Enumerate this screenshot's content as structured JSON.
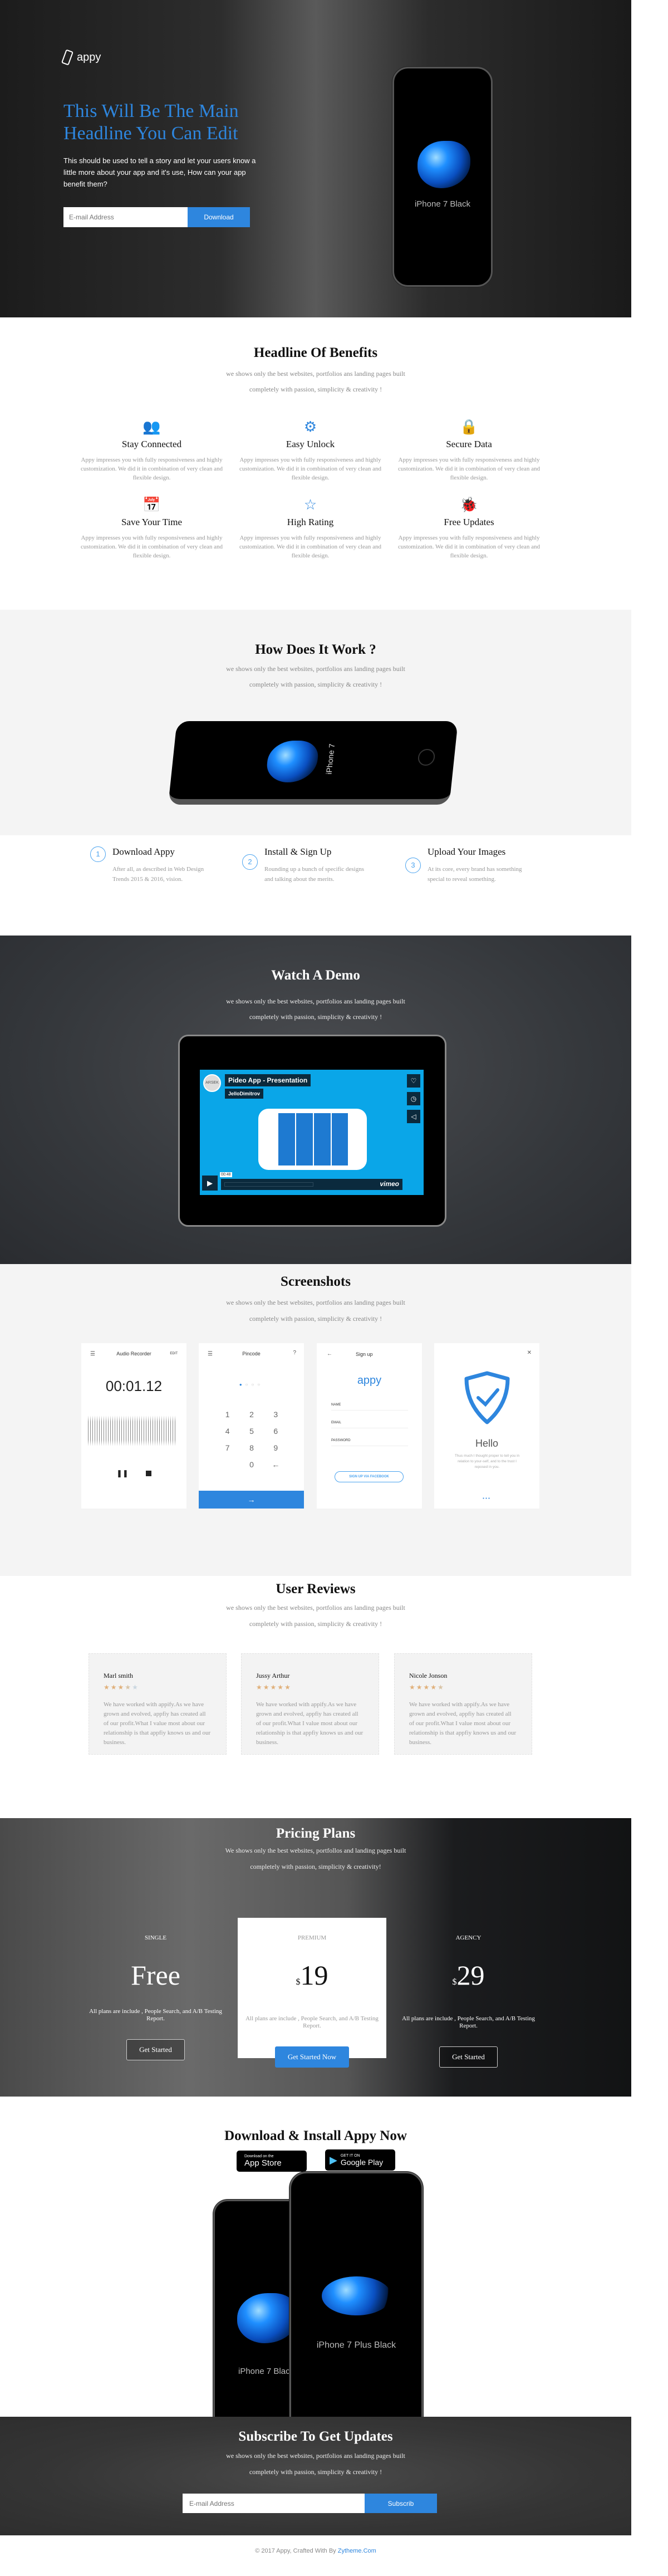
{
  "colors": {
    "accent": "#2e86de",
    "dark": "#2b2b2b",
    "gray_bg": "#f4f4f4"
  },
  "hero": {
    "logo_text": "appy",
    "logo_icon": "phone-outline-icon",
    "headline": "This Will Be The Main Headline You Can Edit",
    "description": "This should be used to tell a story and let your users know a little more about your app and it's use, How can your app benefit them?",
    "email_placeholder": "E-mail Address",
    "download_label": "Download",
    "phone_caption": "iPhone 7 Black"
  },
  "section_subtitle_line1": "we shows only the best websites, portfolios ans landing pages built",
  "section_subtitle_line2": "completely with passion, simplicity & creativity !",
  "benefits": {
    "title": "Headline Of Benefits",
    "items": [
      {
        "icon": "users-icon",
        "title": "Stay Connected",
        "desc": "Appy impresses you with fully responsiveness and highly customization. We did it in combination of very clean and flexible design."
      },
      {
        "icon": "gear-icon",
        "title": "Easy Unlock",
        "desc": "Appy impresses you with fully responsiveness and highly customization. We did it in combination of very clean and flexible design."
      },
      {
        "icon": "lock-icon",
        "title": "Secure Data",
        "desc": "Appy impresses you with fully responsiveness and highly customization. We did it in combination of very clean and flexible design."
      },
      {
        "icon": "calendar-icon",
        "title": "Save Your Time",
        "desc": "Appy impresses you with fully responsiveness and highly customization. We did it in combination of very clean and flexible design."
      },
      {
        "icon": "star-icon",
        "title": "High Rating",
        "desc": "Appy impresses you with fully responsiveness and highly customization. We did it in combination of very clean and flexible design."
      },
      {
        "icon": "bug-icon",
        "title": "Free Updates",
        "desc": "Appy impresses you with fully responsiveness and highly customization. We did it in combination of very clean and flexible design."
      }
    ]
  },
  "how": {
    "title": "How Does It Work ?",
    "phone_caption": "iPhone 7",
    "steps": [
      {
        "num": "1",
        "title": "Download Appy",
        "desc": "After all, as described in Web Design Trends 2015 & 2016, vision."
      },
      {
        "num": "2",
        "title": "Install & Sign Up",
        "desc": "Rounding up a bunch of specific designs and talking about the merits."
      },
      {
        "num": "3",
        "title": "Upload Your Images",
        "desc": "At its core, every brand has something special to reveal something."
      }
    ]
  },
  "demo": {
    "title": "Watch A Demo",
    "video_title": "Pideo App - Presentation",
    "video_author": "JelloDimitrov",
    "channel_badge": "ARSEK",
    "time": "00:48",
    "player_brand": "vimeo"
  },
  "screenshots": {
    "title": "Screenshots",
    "audio": {
      "title": "Audio Recorder",
      "edit": "EDIT",
      "time": "00:01.12"
    },
    "pincode": {
      "title": "Pincode",
      "keys": [
        "1",
        "2",
        "3",
        "4",
        "5",
        "6",
        "7",
        "8",
        "9",
        "0"
      ]
    },
    "signup": {
      "title": "Sign up",
      "logo": "appy",
      "fields": [
        "NAME",
        "EMAIL",
        "PASSWORD"
      ],
      "button": "SIGN UP VIA FACEBOOK"
    },
    "hello": {
      "title": "Hello",
      "text": "Thus much I thought proper to tell you in relation to your-self, and to the trust I reposed in you."
    }
  },
  "reviews": {
    "title": "User Reviews",
    "items": [
      {
        "name": "Marl smith",
        "rating": 3.5,
        "text": "We have worked with appify.As we have grown and evolved, appfiy has created all of our profit.What I value most about our relationship is that appfiy knows us and our business."
      },
      {
        "name": "Jussy Arthur",
        "rating": 5,
        "text": "We have worked with appify.As we have grown and evolved, appfiy has created all of our profit.What I value most about our relationship is that appfiy knows us and our business."
      },
      {
        "name": "Nicole Jonson",
        "rating": 4.5,
        "text": "We have worked with appify.As we have grown and evolved, appfiy has created all of our profit.What I value most about our relationship is that appfiy knows us and our business."
      }
    ]
  },
  "pricing": {
    "title": "Pricing Plans",
    "subtitle_line1": "We shows only the best websites, portfollos and landing pages built",
    "subtitle_line2": "completely with passion, simplicity & creativity!",
    "plans": [
      {
        "label": "SINGLE",
        "currency": "",
        "price": "Free",
        "desc": "All plans are include , People Search, and A/B Testing Report.",
        "button": "Get Started"
      },
      {
        "label": "PREMIUM",
        "currency": "$",
        "price": "19",
        "desc": "All plans are include , People Search, and A/B Testing Report.",
        "button": "Get Started Now"
      },
      {
        "label": "AGENCY",
        "currency": "$",
        "price": "29",
        "desc": "All plans are include , People Search, and A/B Testing Report.",
        "button": "Get Started"
      }
    ]
  },
  "download": {
    "title": "Download & Install Appy Now",
    "appstore_small": "Download on the",
    "appstore_big": "App Store",
    "play_small": "GET IT ON",
    "play_big": "Google Play",
    "phone1_caption": "iPhone 7 Black",
    "phone2_caption": "iPhone 7 Plus Black"
  },
  "subscribe": {
    "title": "Subscribe To Get Updates",
    "email_placeholder": "E-mail Address",
    "button": "Subscrib"
  },
  "footer": {
    "text": "© 2017 Appy, Crafted With  By ",
    "link": "Zytheme.Com"
  }
}
